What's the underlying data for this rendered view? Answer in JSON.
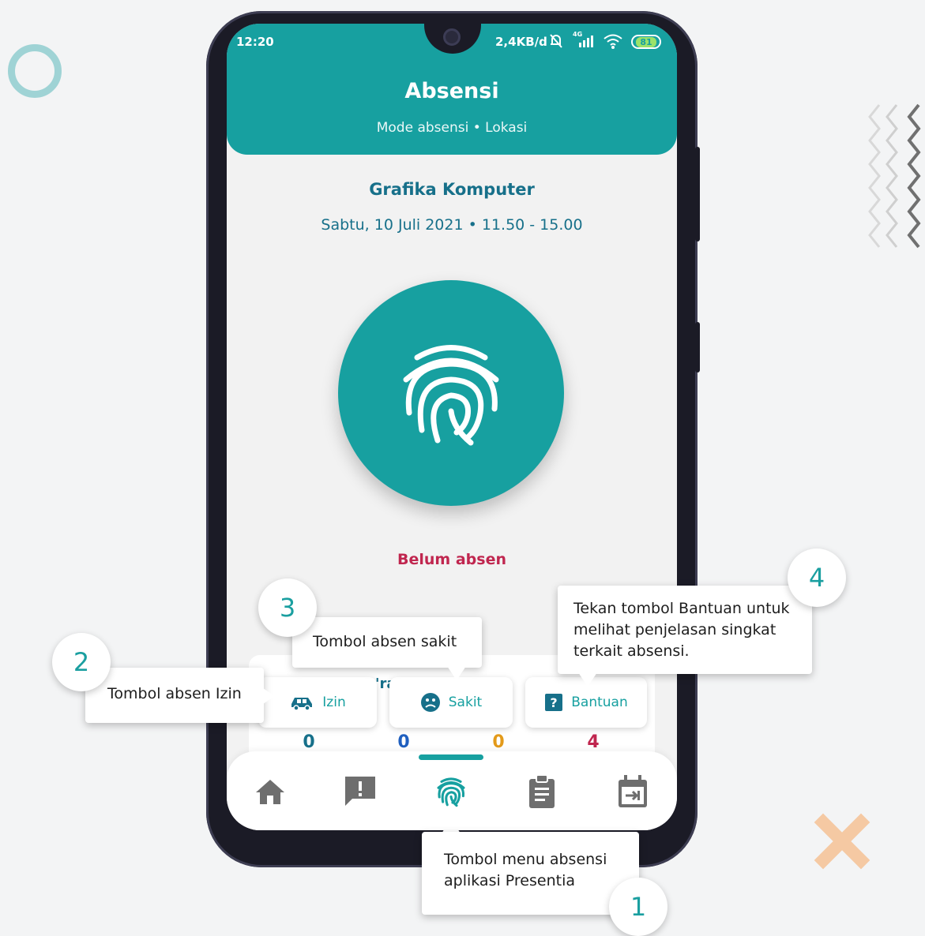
{
  "status_bar": {
    "time": "12:20",
    "speed": "2,4KB/d",
    "network": "4G",
    "battery": "81"
  },
  "header": {
    "title": "Absensi",
    "subtitle": "Mode absensi • Lokasi"
  },
  "course": {
    "name": "Grafika Komputer",
    "schedule": "Sabtu, 10 Juli 2021 • 11.50 - 15.00"
  },
  "attendance": {
    "status": "Belum absen",
    "peek_text": "'ra"
  },
  "actions": {
    "izin": "Izin",
    "sakit": "Sakit",
    "bantuan": "Bantuan"
  },
  "counts": [
    {
      "value": "0",
      "color": "#17708a"
    },
    {
      "value": "0",
      "color": "#1f5fbf"
    },
    {
      "value": "0",
      "color": "#e39a1a"
    },
    {
      "value": "4",
      "color": "#c0264f"
    }
  ],
  "nav": {
    "items": [
      "home-icon",
      "report-icon",
      "fingerprint-icon",
      "clipboard-icon",
      "calendar-icon"
    ]
  },
  "callouts": {
    "c1": {
      "number": "1",
      "lines": [
        "Tombol menu absensi",
        "aplikasi Presentia"
      ]
    },
    "c2": {
      "number": "2",
      "text": "Tombol absen Izin"
    },
    "c3": {
      "number": "3",
      "text": "Tombol absen sakit"
    },
    "c4": {
      "number": "4",
      "lines": [
        "Tekan tombol Bantuan untuk",
        "melihat penjelasan singkat",
        "terkait absensi."
      ]
    }
  },
  "colors": {
    "accent": "#17a0a0",
    "status_red": "#c0264f",
    "decor_orange": "#f5c9a3",
    "decor_ring": "#9fd3d5"
  }
}
